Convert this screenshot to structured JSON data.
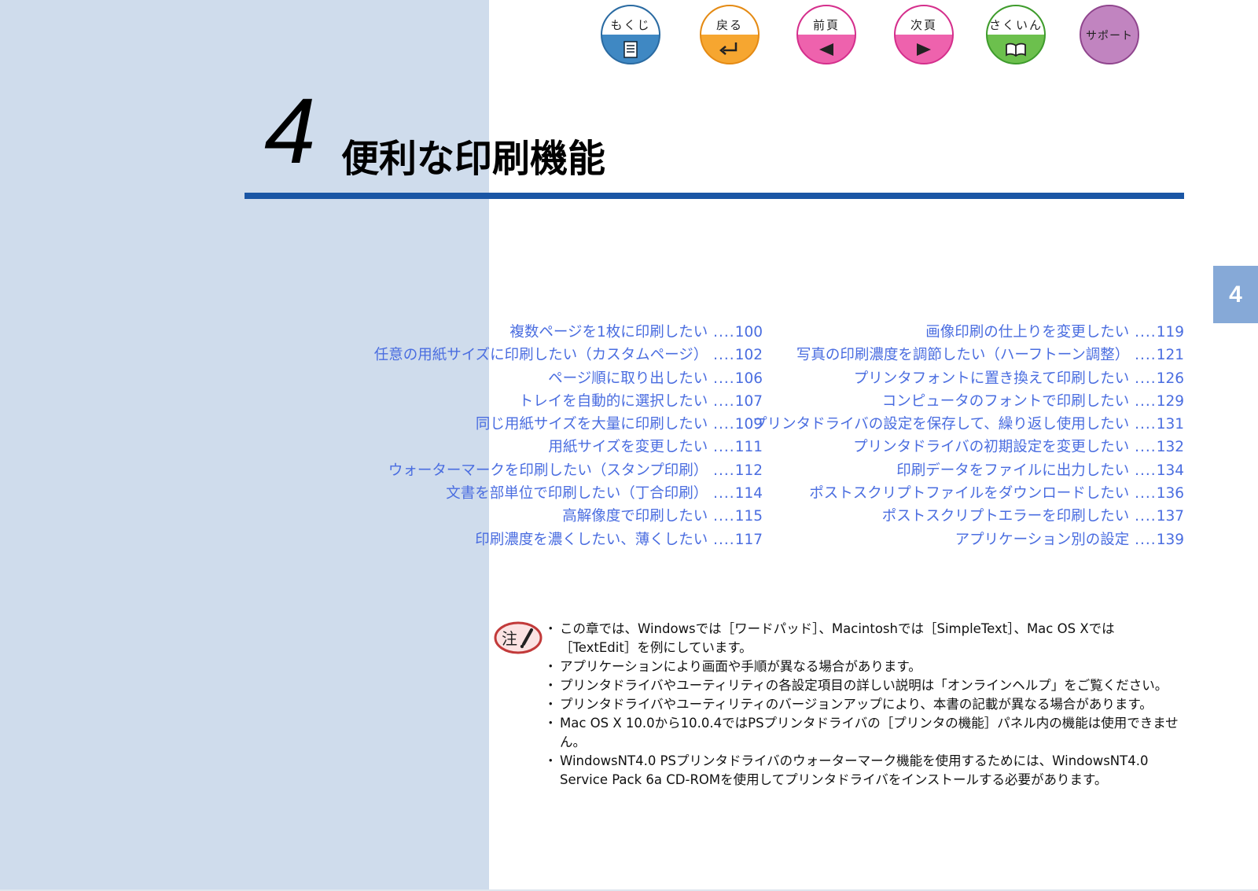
{
  "nav": {
    "contents": "もくじ",
    "back": "戻る",
    "prev": "前頁",
    "next": "次頁",
    "index": "さくいん",
    "support": "サポート"
  },
  "chapter": {
    "number": "4",
    "title": "便利な印刷機能",
    "tab": "4"
  },
  "toc": {
    "left": [
      {
        "label": "複数ページを1枚に印刷したい",
        "page": "100"
      },
      {
        "label": "任意の用紙サイズに印刷したい（カスタムページ）",
        "page": "102"
      },
      {
        "label": "ページ順に取り出したい",
        "page": "106"
      },
      {
        "label": "トレイを自動的に選択したい",
        "page": "107"
      },
      {
        "label": "同じ用紙サイズを大量に印刷したい",
        "page": "109"
      },
      {
        "label": "用紙サイズを変更したい",
        "page": "111"
      },
      {
        "label": "ウォーターマークを印刷したい（スタンプ印刷）",
        "page": "112"
      },
      {
        "label": "文書を部単位で印刷したい（丁合印刷）",
        "page": "114"
      },
      {
        "label": "高解像度で印刷したい",
        "page": "115"
      },
      {
        "label": "印刷濃度を濃くしたい、薄くしたい",
        "page": "117"
      }
    ],
    "right": [
      {
        "label": "画像印刷の仕上りを変更したい",
        "page": "119"
      },
      {
        "label": "写真の印刷濃度を調節したい（ハーフトーン調整）",
        "page": "121"
      },
      {
        "label": "プリンタフォントに置き換えて印刷したい",
        "page": "126"
      },
      {
        "label": "コンピュータのフォントで印刷したい",
        "page": "129"
      },
      {
        "label": "プリンタドライバの設定を保存して、繰り返し使用したい",
        "page": "131"
      },
      {
        "label": "プリンタドライバの初期設定を変更したい",
        "page": "132"
      },
      {
        "label": "印刷データをファイルに出力したい",
        "page": "134"
      },
      {
        "label": "ポストスクリプトファイルをダウンロードしたい",
        "page": "136"
      },
      {
        "label": "ポストスクリプトエラーを印刷したい",
        "page": "137"
      },
      {
        "label": "アプリケーション別の設定",
        "page": "139"
      }
    ]
  },
  "note": {
    "icon_label": "注",
    "items": [
      "この章では、Windowsでは［ワードパッド］、Macintoshでは［SimpleText］、Mac OS Xでは［TextEdit］を例にしています。",
      "アプリケーションにより画面や手順が異なる場合があります。",
      "プリンタドライバやユーティリティの各設定項目の詳しい説明は「オンラインヘルプ」をご覧ください。",
      "プリンタドライバやユーティリティのバージョンアップにより、本書の記載が異なる場合があります。",
      "Mac OS X 10.0から10.0.4ではPSプリンタドライバの［プリンタの機能］パネル内の機能は使用できません。",
      "WindowsNT4.0 PSプリンタドライバのウォーターマーク機能を使用するためには、WindowsNT4.0 Service Pack 6a CD-ROMを使用してプリンタドライバをインストールする必要があります。"
    ]
  },
  "colors": {
    "left_panel": "#cfdcec",
    "rule": "#1a56a5",
    "toc_link": "#4a6de0",
    "tab": "#86a9d7"
  }
}
